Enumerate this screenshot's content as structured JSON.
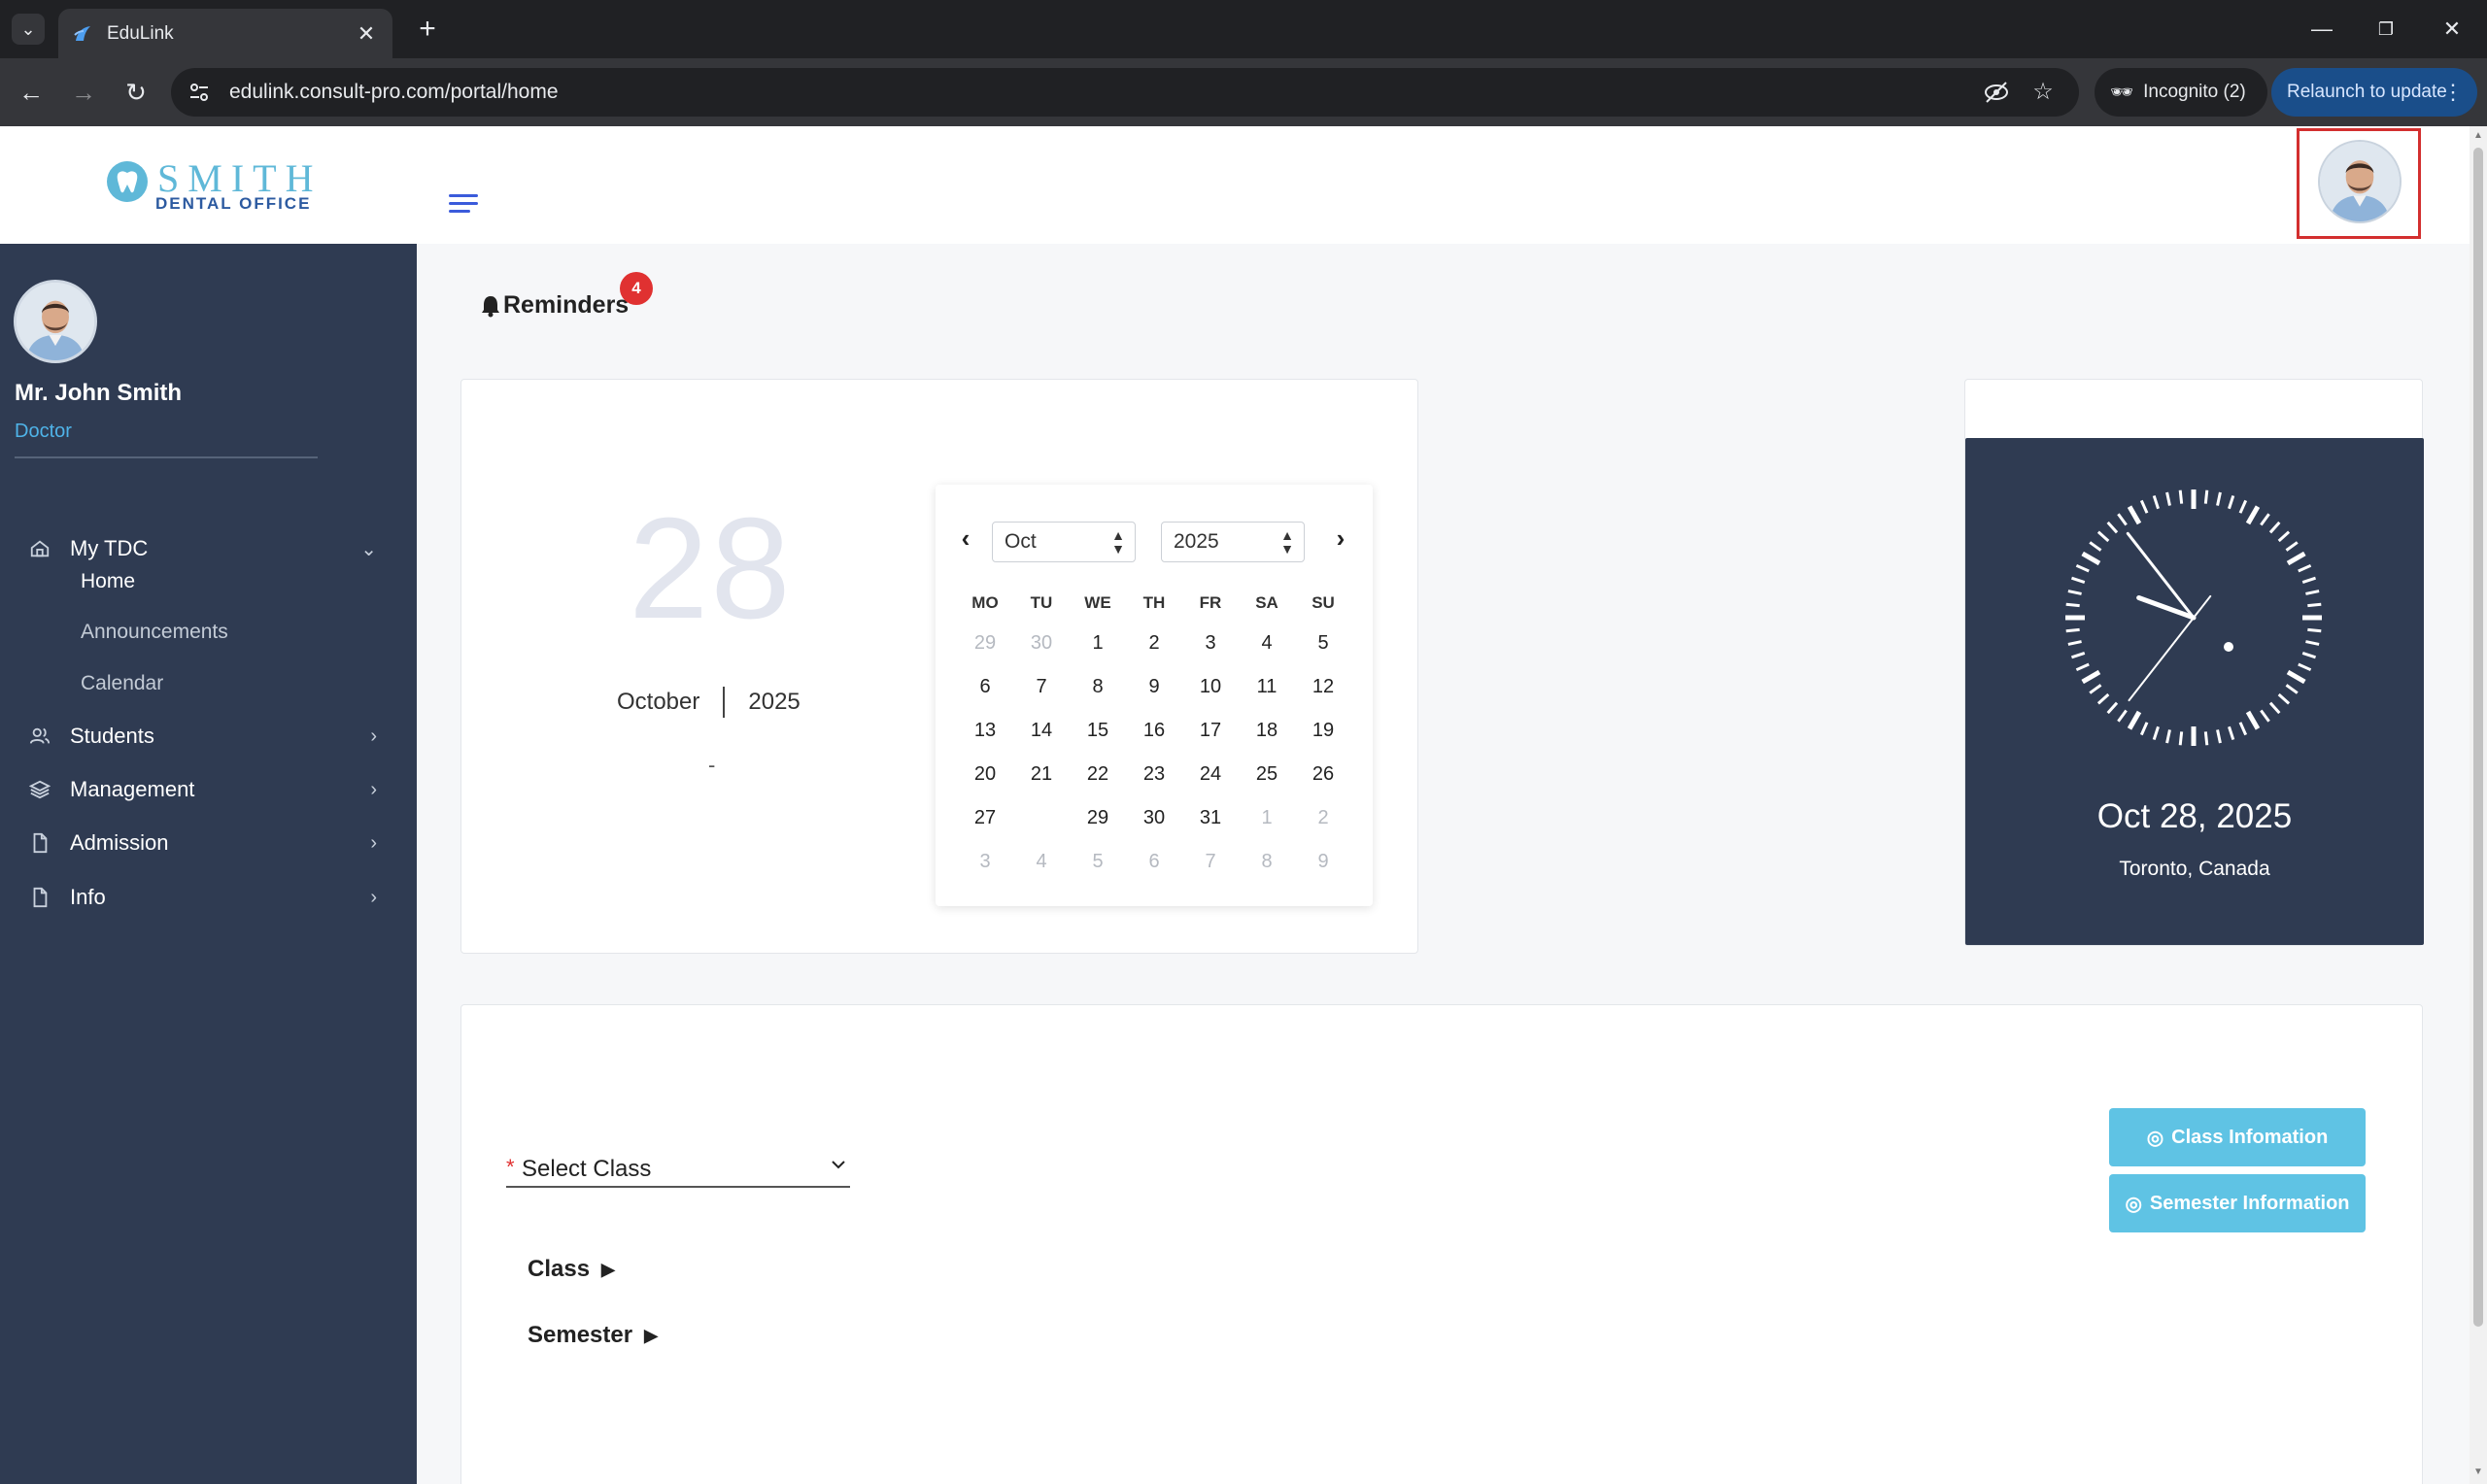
{
  "browser": {
    "tab_title": "EduLink",
    "url": "edulink.consult-pro.com/portal/home",
    "incognito_label": "Incognito (2)",
    "relaunch_label": "Relaunch to update"
  },
  "header": {
    "logo_main": "SMITH",
    "logo_sub": "DENTAL OFFICE"
  },
  "profile": {
    "name": "Mr. John Smith",
    "role": "Doctor"
  },
  "sidebar": {
    "my_tdc": "My TDC",
    "sub_items": [
      "Home",
      "Announcements",
      "Calendar"
    ],
    "students": "Students",
    "management": "Management",
    "admission": "Admission",
    "info": "Info"
  },
  "reminders": {
    "label": "Reminders",
    "count": "4"
  },
  "date_card": {
    "day": "28",
    "month": "October",
    "year": "2025",
    "note": "-"
  },
  "calendar": {
    "month_select": "Oct",
    "year_select": "2025",
    "weekdays": [
      "MO",
      "TU",
      "WE",
      "TH",
      "FR",
      "SA",
      "SU"
    ],
    "weeks": [
      [
        "29",
        "30",
        "1",
        "2",
        "3",
        "4",
        "5"
      ],
      [
        "6",
        "7",
        "8",
        "9",
        "10",
        "11",
        "12"
      ],
      [
        "13",
        "14",
        "15",
        "16",
        "17",
        "18",
        "19"
      ],
      [
        "20",
        "21",
        "22",
        "23",
        "24",
        "25",
        "26"
      ],
      [
        "27",
        "",
        "29",
        "30",
        "31",
        "1",
        "2"
      ],
      [
        "3",
        "4",
        "5",
        "6",
        "7",
        "8",
        "9"
      ]
    ]
  },
  "clock": {
    "date": "Oct 28, 2025",
    "location": "Toronto, Canada"
  },
  "class_panel": {
    "select_placeholder": "Select Class",
    "class_label": "Class",
    "semester_label": "Semester",
    "class_info_button": "Class Infomation",
    "semester_info_button": "Semester Information"
  },
  "colors": {
    "sidebar_bg": "#2f3b52",
    "accent_blue": "#4fb3e8",
    "button_bg": "#5fc3e4",
    "badge_red": "#e03131",
    "highlight_red": "#d32f2f"
  }
}
